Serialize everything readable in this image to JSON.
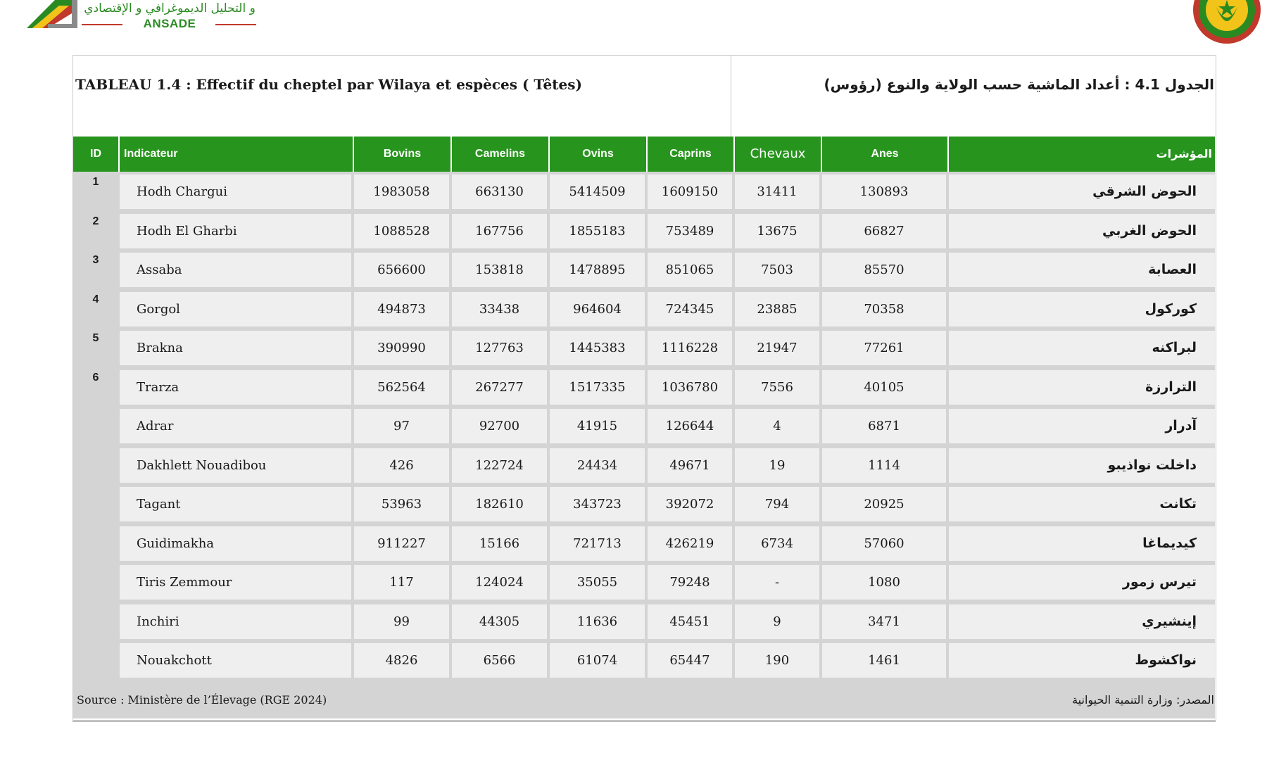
{
  "header": {
    "logo_arabic": "و التحليل الديموغرافي و الإقتصادي",
    "logo_acronym": "ANSADE"
  },
  "table": {
    "title_fr": "TABLEAU 1.4 : Effectif du cheptel par Wilaya et espèces (  Têtes)",
    "title_ar": "الجدول 4.1 : أعداد الماشية حسب الولاية والنوع (رؤوس)",
    "columns": {
      "id": "ID",
      "indicateur": "Indicateur",
      "bovins": "Bovins",
      "camelins": "Camelins",
      "ovins": "Ovins",
      "caprins": "Caprins",
      "chevaux": "Chevaux",
      "anes": "Anes",
      "indicators_ar": "المؤشرات"
    },
    "rows": [
      {
        "id": "1",
        "name": "Hodh Chargui",
        "bovins": "1983058",
        "camelins": "663130",
        "ovins": "5414509",
        "caprins": "1609150",
        "chevaux": "31411",
        "anes": "130893",
        "name_ar": "الحوض الشرقي"
      },
      {
        "id": "2",
        "name": "Hodh El Gharbi",
        "bovins": "1088528",
        "camelins": "167756",
        "ovins": "1855183",
        "caprins": "753489",
        "chevaux": "13675",
        "anes": "66827",
        "name_ar": "الحوض الغربي"
      },
      {
        "id": "3",
        "name": "Assaba",
        "bovins": "656600",
        "camelins": "153818",
        "ovins": "1478895",
        "caprins": "851065",
        "chevaux": "7503",
        "anes": "85570",
        "name_ar": "العصابة"
      },
      {
        "id": "4",
        "name": "Gorgol",
        "bovins": "494873",
        "camelins": "33438",
        "ovins": "964604",
        "caprins": "724345",
        "chevaux": "23885",
        "anes": "70358",
        "name_ar": "كوركول"
      },
      {
        "id": "5",
        "name": "Brakna",
        "bovins": "390990",
        "camelins": "127763",
        "ovins": "1445383",
        "caprins": "1116228",
        "chevaux": "21947",
        "anes": "77261",
        "name_ar": "لبراكنه"
      },
      {
        "id": "6",
        "name": "Trarza",
        "bovins": "562564",
        "camelins": "267277",
        "ovins": "1517335",
        "caprins": "1036780",
        "chevaux": "7556",
        "anes": "40105",
        "name_ar": "الترارزة"
      },
      {
        "id": "",
        "name": "Adrar",
        "bovins": "97",
        "camelins": "92700",
        "ovins": "41915",
        "caprins": "126644",
        "chevaux": "4",
        "anes": "6871",
        "name_ar": "آدرار"
      },
      {
        "id": "",
        "name": "Dakhlett Nouadibou",
        "bovins": "426",
        "camelins": "122724",
        "ovins": "24434",
        "caprins": "49671",
        "chevaux": "19",
        "anes": "1114",
        "name_ar": "داخلت نواذيبو"
      },
      {
        "id": "",
        "name": "Tagant",
        "bovins": "53963",
        "camelins": "182610",
        "ovins": "343723",
        "caprins": "392072",
        "chevaux": "794",
        "anes": "20925",
        "name_ar": "تكانت"
      },
      {
        "id": "",
        "name": "Guidimakha",
        "bovins": "911227",
        "camelins": "15166",
        "ovins": "721713",
        "caprins": "426219",
        "chevaux": "6734",
        "anes": "57060",
        "name_ar": "كيديماغا"
      },
      {
        "id": "",
        "name": "Tiris Zemmour",
        "bovins": "117",
        "camelins": "124024",
        "ovins": "35055",
        "caprins": "79248",
        "chevaux": "-",
        "anes": "1080",
        "name_ar": "تيرس زمور"
      },
      {
        "id": "",
        "name": "Inchiri",
        "bovins": "99",
        "camelins": "44305",
        "ovins": "11636",
        "caprins": "45451",
        "chevaux": "9",
        "anes": "3471",
        "name_ar": "إينشيري"
      },
      {
        "id": "",
        "name": "Nouakchott",
        "bovins": "4826",
        "camelins": "6566",
        "ovins": "61074",
        "caprins": "65447",
        "chevaux": "190",
        "anes": "1461",
        "name_ar": "نواكشوط"
      }
    ],
    "source_fr": "Source : Ministère de l’Élevage (RGE 2024)",
    "source_ar": "المصدر: وزارة التنمية الحيوانية"
  },
  "colors": {
    "header_green": "#27951d",
    "row_bg": "#efefef",
    "gutter_gray": "#d4d4d4"
  }
}
